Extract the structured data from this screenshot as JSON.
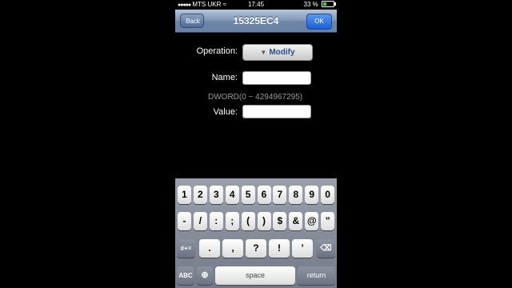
{
  "status": {
    "carrier": "MTS UKR",
    "time": "17:45",
    "battery_text": "33 %",
    "battery_level": 0.33,
    "signal_icon": "signal-dots-icon",
    "wifi_icon": "wifi-icon"
  },
  "nav": {
    "back_label": "Back",
    "title": "15325EC4",
    "ok_label": "OK"
  },
  "form": {
    "operation_label": "Operation:",
    "operation_value": "Modify",
    "name_label": "Name:",
    "name_value": "",
    "hint": "DWORD(0 ~ 4294967295)",
    "value_label": "Value:",
    "value_value": ""
  },
  "keyboard": {
    "row1": [
      "1",
      "2",
      "3",
      "4",
      "5",
      "6",
      "7",
      "8",
      "9",
      "0"
    ],
    "row2": [
      "-",
      "/",
      ":",
      ";",
      "(",
      ")",
      "$",
      "&",
      "@",
      "”"
    ],
    "row3_left": "#+=",
    "row3": [
      ".",
      ",",
      "?",
      "!",
      "’"
    ],
    "abc": "ABC",
    "space": "space",
    "return": "return"
  }
}
